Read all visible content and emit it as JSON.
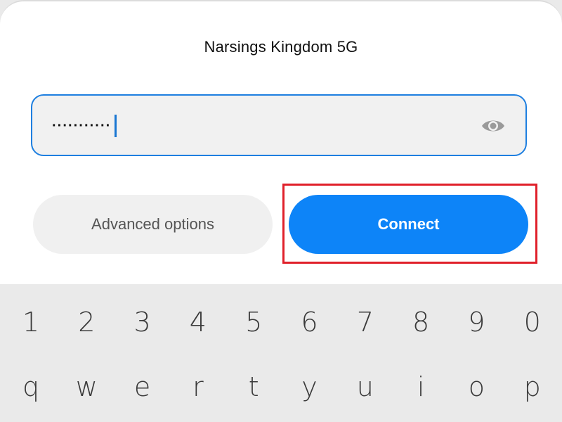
{
  "dialog": {
    "network_name": "Narsings Kingdom 5G"
  },
  "password_field": {
    "value": "···········",
    "visibility_icon": "eye-icon"
  },
  "buttons": {
    "advanced_label": "Advanced options",
    "connect_label": "Connect"
  },
  "colors": {
    "accent": "#0d84f8",
    "field_border": "#1e7fe0",
    "highlight": "#e0202a"
  },
  "keyboard": {
    "number_row": [
      "1",
      "2",
      "3",
      "4",
      "5",
      "6",
      "7",
      "8",
      "9",
      "0"
    ],
    "letter_row": [
      "q",
      "w",
      "e",
      "r",
      "t",
      "y",
      "u",
      "i",
      "o",
      "p"
    ]
  }
}
